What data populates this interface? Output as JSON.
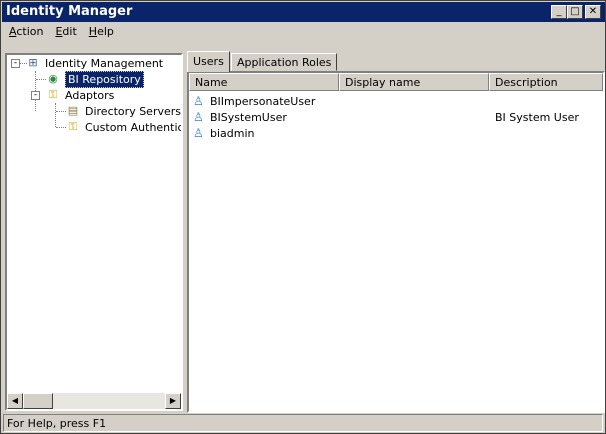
{
  "window": {
    "title": "Identity Manager",
    "minimize": "_",
    "maximize": "□",
    "close": "✕"
  },
  "menu": [
    "Action",
    "Edit",
    "Help"
  ],
  "tree": {
    "root": "Identity Management",
    "repository": "BI Repository",
    "adaptors": "Adaptors",
    "children": [
      "Directory Servers",
      "Custom Authenticat"
    ]
  },
  "tabs": [
    "Users",
    "Application Roles"
  ],
  "columns": [
    "Name",
    "Display name",
    "Description"
  ],
  "users": [
    {
      "name": "BIImpersonateUser",
      "display": "",
      "description": ""
    },
    {
      "name": "BISystemUser",
      "display": "",
      "description": "BI System User"
    },
    {
      "name": "biadmin",
      "display": "",
      "description": ""
    }
  ],
  "status": "For Help, press F1",
  "colors": {
    "titlebar": "#0a246a",
    "face": "#d4d0c8",
    "selection": "#0a246a"
  }
}
